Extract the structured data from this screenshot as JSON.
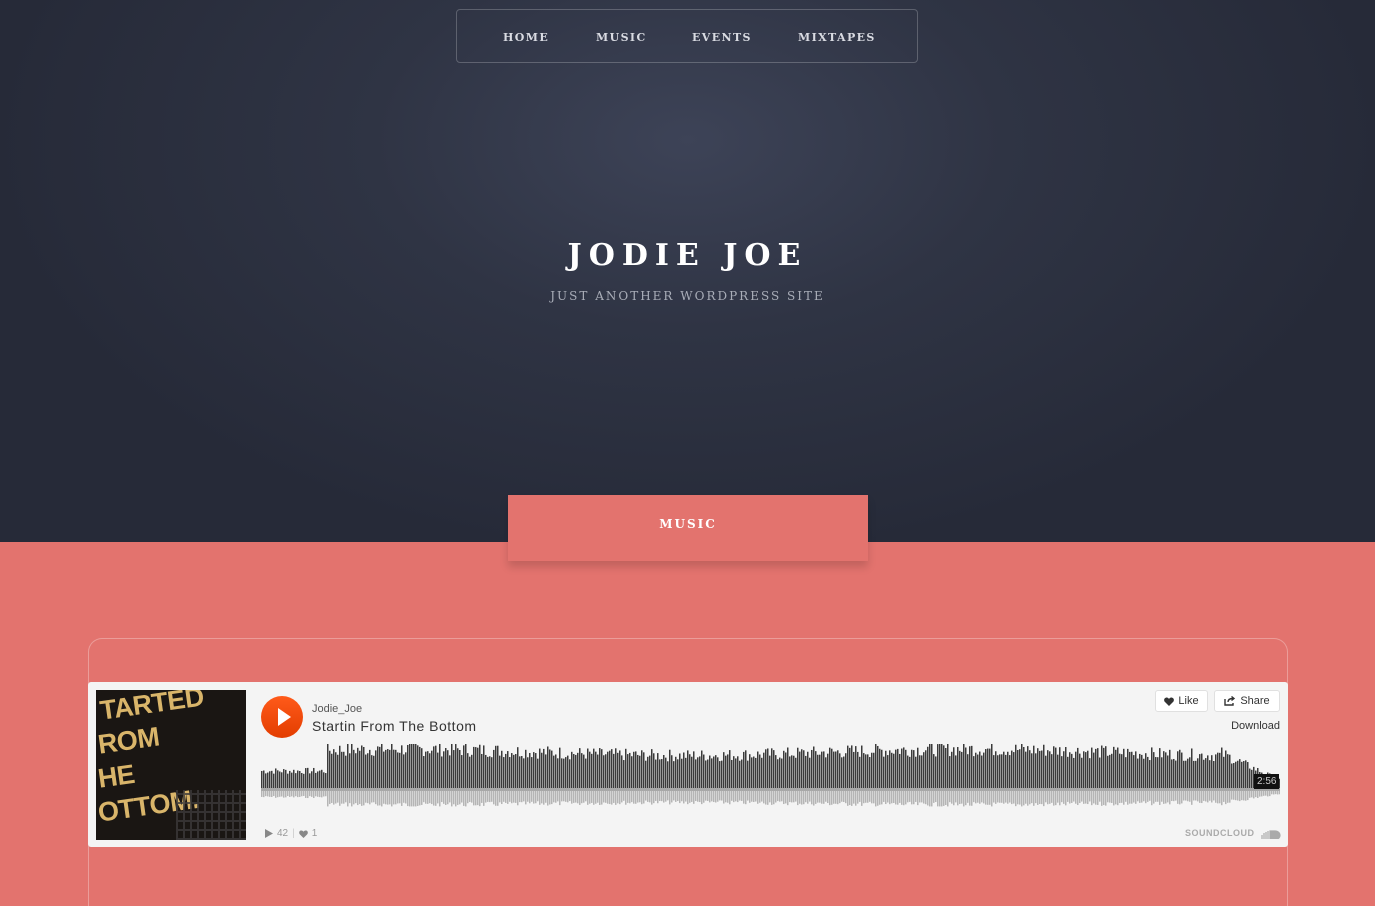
{
  "nav": {
    "items": [
      {
        "label": "HOME"
      },
      {
        "label": "MUSIC"
      },
      {
        "label": "EVENTS"
      },
      {
        "label": "MIXTAPES"
      }
    ]
  },
  "site": {
    "title": "JODIE JOE",
    "tagline": "JUST ANOTHER WORDPRESS SITE"
  },
  "section": {
    "label": "MUSIC"
  },
  "player": {
    "artist": "Jodie_Joe",
    "track": "Startin From The Bottom",
    "artwork_text": [
      "TARTED",
      "ROM",
      "HE",
      "OTTOM."
    ],
    "like_label": "Like",
    "share_label": "Share",
    "download_label": "Download",
    "duration": "2:56",
    "plays": "42",
    "likes": "1",
    "brand": "SOUNDCLOUD"
  },
  "colors": {
    "hero_bg": "#2f3444",
    "section_bg": "#e3736e",
    "play_accent": "#ff5500",
    "waveform": "#333333"
  },
  "icons": {
    "play": "play-icon",
    "like": "heart-icon",
    "share": "share-icon",
    "plays": "play-count-icon",
    "likes": "heart-count-icon",
    "brand": "soundcloud-cloud-icon"
  }
}
